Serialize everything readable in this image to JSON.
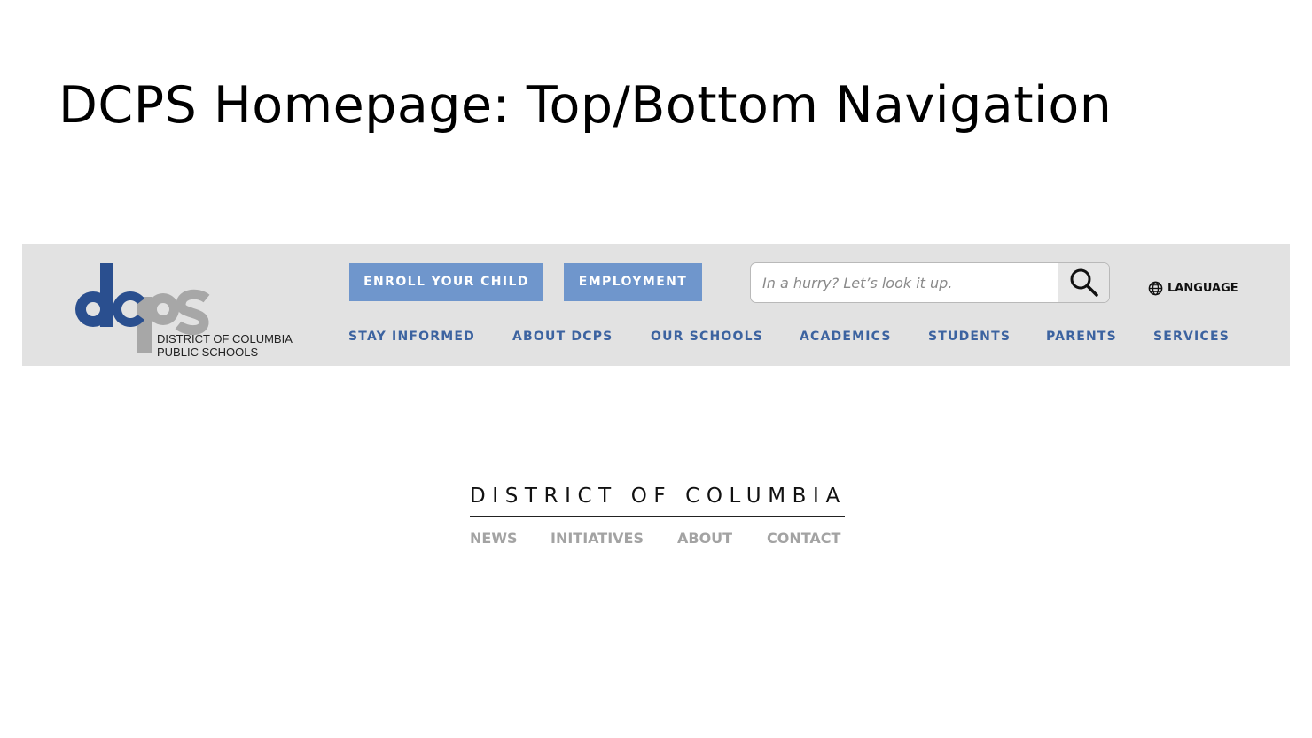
{
  "slide": {
    "title": "DCPS Homepage: Top/Bottom Navigation"
  },
  "header": {
    "logo": {
      "mark_text": "dcps",
      "line1": "DISTRICT OF COLUMBIA",
      "line2": "PUBLIC SCHOOLS",
      "colors": {
        "blue": "#2a4f8f",
        "gray": "#a7a7a7"
      }
    },
    "buttons": {
      "enroll": "ENROLL YOUR CHILD",
      "employment": "EMPLOYMENT"
    },
    "search": {
      "placeholder": "In a hurry? Let’s look it up.",
      "value": "",
      "icon": "search-icon"
    },
    "language": {
      "label": "LANGUAGE",
      "icon": "globe-icon"
    },
    "menu": [
      {
        "label": "STAY INFORMED"
      },
      {
        "label": "ABOUT DCPS"
      },
      {
        "label": "OUR SCHOOLS"
      },
      {
        "label": "ACADEMICS"
      },
      {
        "label": "STUDENTS"
      },
      {
        "label": "PARENTS"
      },
      {
        "label": "SERVICES"
      }
    ],
    "colors": {
      "bar_background": "#e2e2e2",
      "button_background": "#6f96cc",
      "menu_text": "#3c63a0"
    }
  },
  "footer": {
    "title": "DISTRICT OF COLUMBIA",
    "links": [
      {
        "label": "NEWS"
      },
      {
        "label": "INITIATIVES"
      },
      {
        "label": "ABOUT"
      },
      {
        "label": "CONTACT"
      }
    ],
    "colors": {
      "link_text": "#a3a3a3"
    }
  }
}
